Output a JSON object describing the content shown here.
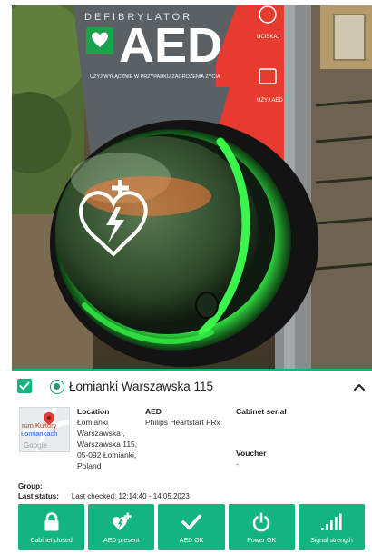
{
  "photo": {
    "sign_brand": "AED",
    "sign_top_text": "DEFIBRYLATOR",
    "sign_subtext": "UŻYJ WYŁĄCZNIE W PRZYPADKU ZAGROŻENIA ŻYCIA",
    "sign_step1": "UCISKAJ",
    "sign_step2": "UŻYJ AED"
  },
  "header": {
    "site_name": "Łomianki Warszawska 115",
    "collapse_icon": "chevron-up-icon"
  },
  "map": {
    "label1": "rum Kultury",
    "label2": "Łomiankach",
    "label3": "Google"
  },
  "location": {
    "heading": "Location",
    "lines": [
      "Łomianki",
      "Warszawska ,",
      "Warszawska 115,",
      "05-092 Łomianki,",
      "Poland"
    ]
  },
  "aed": {
    "heading": "AED",
    "model": "Philips Heartstart FRx"
  },
  "cabinet": {
    "heading": "Cabinet serial",
    "value": ""
  },
  "voucher": {
    "heading": "Voucher",
    "value": "-"
  },
  "group": {
    "label": "Group:"
  },
  "last_status": {
    "label": "Last status:",
    "value": "Last checked: 12:14:40 - 14.05.2023"
  },
  "tiles": [
    {
      "label": "Cabinet closed",
      "icon": "lock-icon"
    },
    {
      "label": "AED present",
      "icon": "heart-bolt-icon"
    },
    {
      "label": "AED OK",
      "icon": "checkmark-icon"
    },
    {
      "label": "Power OK",
      "icon": "power-icon"
    },
    {
      "label": "Signal strength",
      "icon": "signal-bars-icon"
    }
  ],
  "colors": {
    "accent": "#12b47f",
    "sign_red": "#e63b2e",
    "glow_green": "#44ff55"
  }
}
